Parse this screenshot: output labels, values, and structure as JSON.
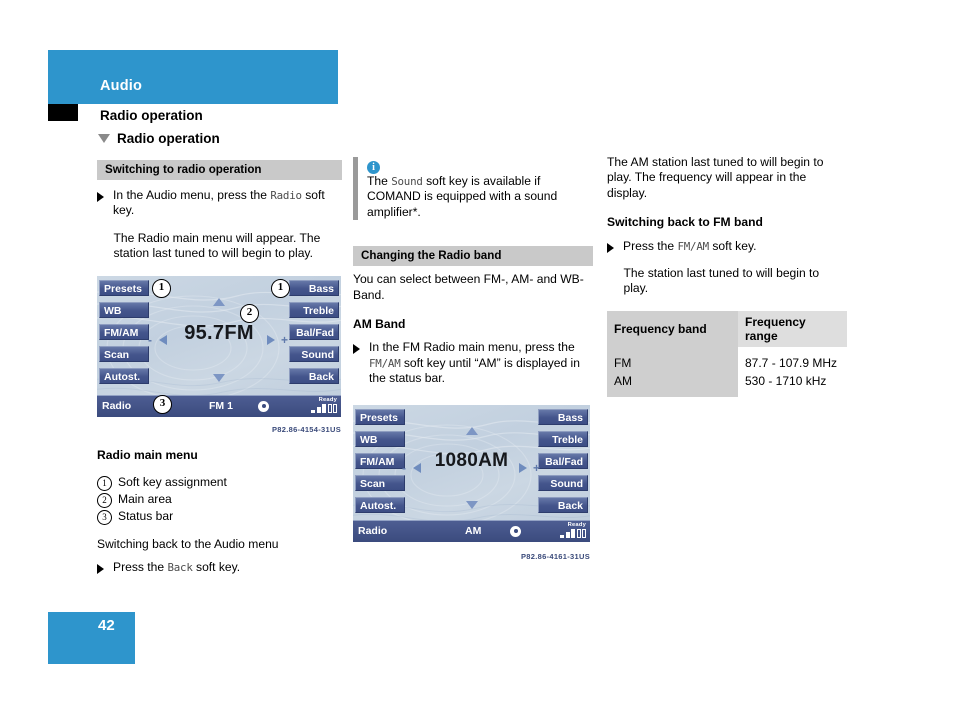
{
  "header": {
    "chapter": "Audio",
    "section": "Radio operation",
    "subsection": "Radio operation"
  },
  "colors": {
    "accent_blue": "#2e95cc",
    "grey_head": "#c9c9c9",
    "softkey_blue": "#44558c",
    "display_bg": "#c5d3e0"
  },
  "left_column": {
    "head_switching": "Switching to radio operation",
    "bullet1_pre": "In the Audio menu, press the ",
    "bullet1_key": "Radio",
    "bullet1_post": " soft key.",
    "para1": "The Radio main menu will appear. The station last tuned to will begin to play.",
    "figure": {
      "softkeys_left": [
        "Presets",
        "WB",
        "FM/AM",
        "Scan",
        "Autost."
      ],
      "softkeys_right": [
        "Bass",
        "Treble",
        "Bal/Fad",
        "Sound",
        "Back"
      ],
      "frequency": "95.7FM",
      "status_left": "Radio",
      "status_mid": "FM 1",
      "status_ready": "Ready",
      "callouts": [
        "1",
        "1",
        "2",
        "3"
      ],
      "minus": "-",
      "plus": "+",
      "image_code": "P82.86-4154-31US"
    },
    "caption": "Radio main menu",
    "legend": [
      {
        "num": "1",
        "text": "Soft key assignment"
      },
      {
        "num": "2",
        "text": "Main area"
      },
      {
        "num": "3",
        "text": "Status bar"
      }
    ],
    "para_switch_back": "Switching back to the Audio menu",
    "bullet2_pre": "Press the ",
    "bullet2_key": "Back",
    "bullet2_post": " soft key."
  },
  "middle_column": {
    "note": {
      "icon": "info-icon",
      "pre": "The ",
      "key": "Sound",
      "post": " soft key is available if COMAND is equipped with a sound amplifier*."
    },
    "head_changing": "Changing the Radio band",
    "para1": "You can select between FM-, AM- and WB-Band.",
    "head_am": "AM Band",
    "bullet1_pre": "In the FM Radio main menu, press the ",
    "bullet1_key": "FM/AM",
    "bullet1_post": " soft key until “AM” is displayed in the status bar.",
    "figure": {
      "softkeys_left": [
        "Presets",
        "WB",
        "FM/AM",
        "Scan",
        "Autost."
      ],
      "softkeys_right": [
        "Bass",
        "Treble",
        "Bal/Fad",
        "Sound",
        "Back"
      ],
      "frequency": "1080AM",
      "status_left": "Radio",
      "status_mid": "AM",
      "status_ready": "Ready",
      "minus": "-",
      "plus": "+",
      "image_code": "P82.86-4161-31US"
    }
  },
  "right_column": {
    "para1": "The AM station last tuned to will begin to play. The frequency will appear in the display.",
    "head_switch_fm": "Switching back to FM band",
    "bullet1_pre": "Press the ",
    "bullet1_key": "FM/AM",
    "bullet1_post": " soft key.",
    "para2": "The station last tuned to will begin to play.",
    "table": {
      "headers": [
        "Frequency band",
        "Frequency range"
      ],
      "rows": [
        [
          "FM",
          "87.7 - 107.9 MHz"
        ],
        [
          "AM",
          "530 - 1710 kHz"
        ]
      ]
    }
  },
  "footer": {
    "page_number": "42"
  }
}
